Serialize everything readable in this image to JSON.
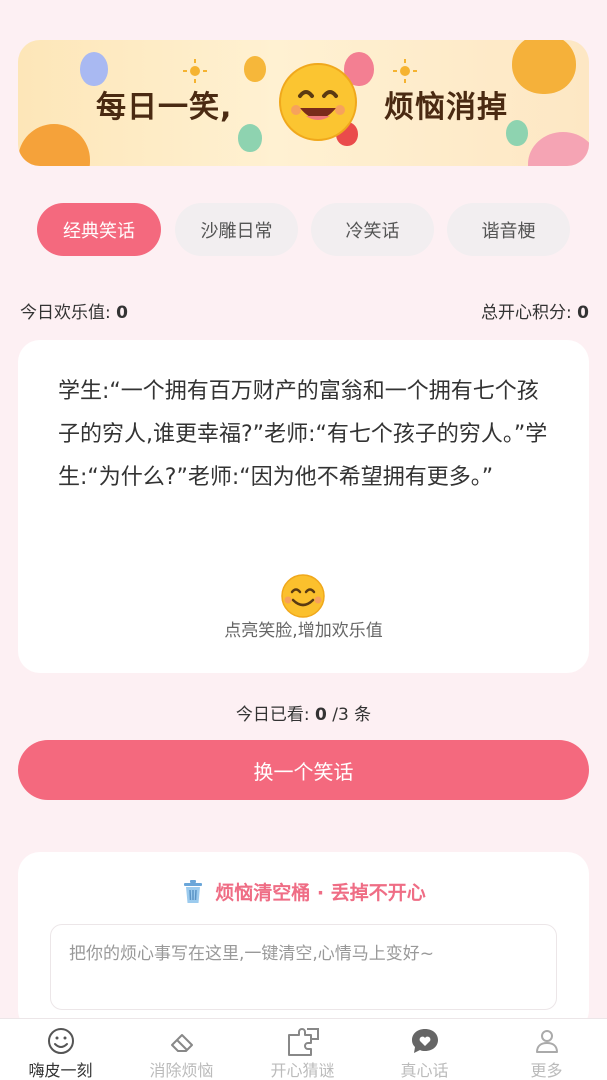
{
  "banner": {
    "title_left": "每日一笑,",
    "title_right": "烦恼消掉"
  },
  "tabs": [
    {
      "label": "经典笑话",
      "active": true
    },
    {
      "label": "沙雕日常",
      "active": false
    },
    {
      "label": "冷笑话",
      "active": false
    },
    {
      "label": "谐音梗",
      "active": false
    }
  ],
  "stats": {
    "today_label": "今日欢乐值:",
    "today_value": "0",
    "total_label": "总开心积分:",
    "total_value": "0"
  },
  "joke": {
    "text": "学生:“一个拥有百万财产的富翁和一个拥有七个孩子的穷人,谁更幸福?”老师:“有七个孩子的穷人。”学生:“为什么?”老师:“因为他不希望拥有更多。”",
    "smile_hint": "点亮笑脸,增加欢乐值"
  },
  "watched": {
    "prefix": "今日已看:",
    "count": "0",
    "suffix": "/3 条"
  },
  "next_button": "换一个笑话",
  "trash": {
    "title": "烦恼清空桶 · 丢掉不开心",
    "placeholder": "把你的烦心事写在这里,一键清空,心情马上变好~"
  },
  "nav": [
    {
      "label": "嗨皮一刻",
      "icon": "smiley-icon",
      "active": true
    },
    {
      "label": "消除烦恼",
      "icon": "eraser-icon",
      "active": false
    },
    {
      "label": "开心猜谜",
      "icon": "puzzle-icon",
      "active": false
    },
    {
      "label": "真心话",
      "icon": "heart-chat-icon",
      "active": false
    },
    {
      "label": "更多",
      "icon": "user-icon",
      "active": false
    }
  ],
  "colors": {
    "accent": "#f4697e",
    "background": "#fdf0f3",
    "trash_title": "#ef6d85"
  }
}
